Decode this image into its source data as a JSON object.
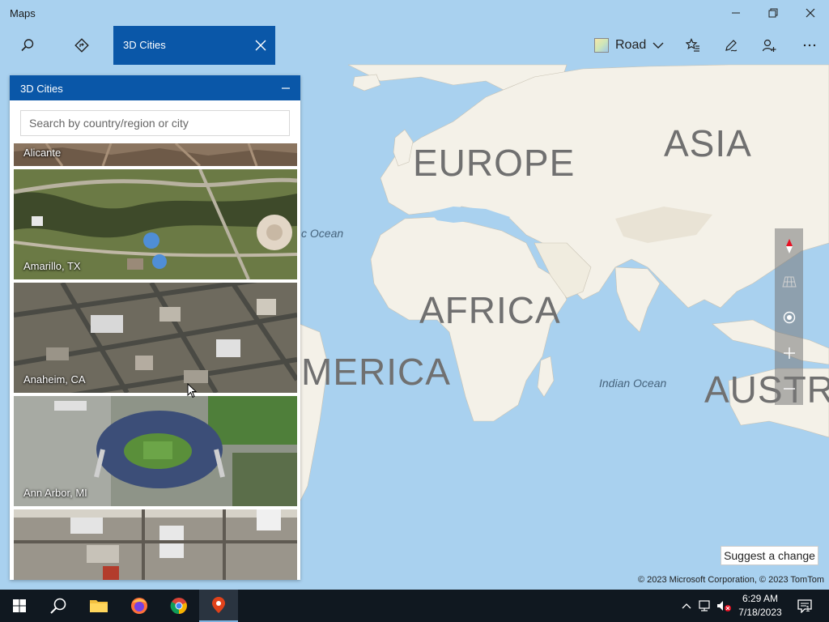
{
  "window": {
    "title": "Maps"
  },
  "toolbar": {
    "search_icon": "search-icon",
    "directions_icon": "directions-icon",
    "active_tab_label": "3D Cities",
    "map_style_label": "Road",
    "favorites_icon": "favorites-icon",
    "ink_icon": "pen-icon",
    "sign_in_icon": "person-add-icon",
    "more_icon": "more-icon"
  },
  "panel": {
    "title": "3D Cities",
    "search_placeholder": "Search by country/region or city",
    "cities": [
      {
        "label": "Alicante"
      },
      {
        "label": "Amarillo, TX"
      },
      {
        "label": "Anaheim, CA"
      },
      {
        "label": "Ann Arbor, MI"
      },
      {
        "label": ""
      }
    ]
  },
  "map": {
    "labels": {
      "europe": "EUROPE",
      "asia": "ASIA",
      "africa": "AFRICA",
      "america": "MERICA",
      "australia": "AUSTRA",
      "atlantic": "c Ocean",
      "indian": "Indian Ocean"
    },
    "suggest_label": "Suggest a change",
    "copyright": "© 2023 Microsoft Corporation, © 2023 TomTom"
  },
  "taskbar": {
    "time": "6:29 AM",
    "date": "7/18/2023",
    "notification_count": "1"
  },
  "colors": {
    "accent": "#0a57a8",
    "water": "#a9d1ef",
    "land": "#f4f1e8",
    "taskbar": "#101820"
  }
}
